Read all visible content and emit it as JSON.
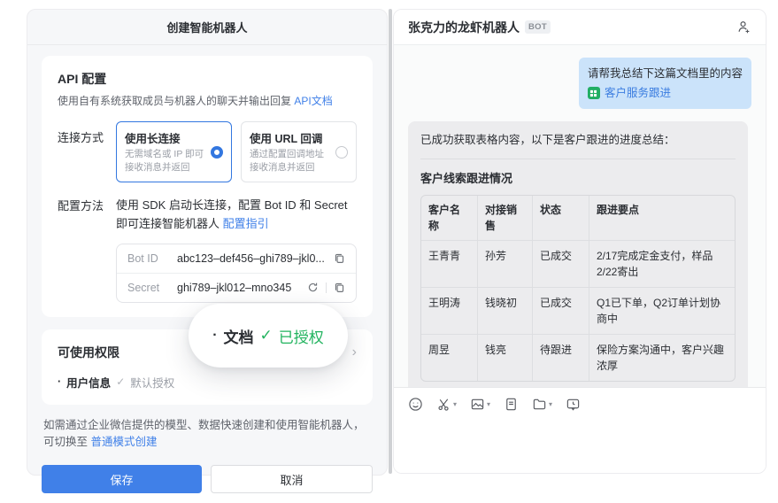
{
  "colors": {
    "accent_blue": "#4080e8",
    "radio_blue": "#3377e0",
    "link_blue": "#3b7de0",
    "success_green": "#21b35e",
    "attachment_green": "#21ae63",
    "user_bubble": "#cbe3fa",
    "bot_bubble": "#ececee",
    "panel_bg": "#f6f7f9"
  },
  "left_panel": {
    "title": "创建智能机器人",
    "api_section": {
      "title": "API 配置",
      "desc": "使用自有系统获取成员与机器人的聊天并输出回复",
      "doc_link": "API文档",
      "connection_label": "连接方式",
      "options": [
        {
          "title": "使用长连接",
          "desc1": "无需域名或 IP 即可",
          "desc2": "接收消息并返回",
          "selected": true
        },
        {
          "title": "使用 URL 回调",
          "desc1": "通过配置回调地址",
          "desc2": "接收消息并返回",
          "selected": false
        }
      ],
      "config_label": "配置方法",
      "config_desc": "使用 SDK 启动长连接，配置 Bot ID 和 Secret 即可连接智能机器人",
      "config_link": "配置指引",
      "credentials": {
        "bot_id_label": "Bot ID",
        "bot_id_value": "abc123–def456–ghi789–jkl0...",
        "secret_label": "Secret",
        "secret_value": "ghi789–jkl012–mno345"
      }
    },
    "permission_section": {
      "title": "可使用权限",
      "items": [
        {
          "bullet": "·",
          "name": "用户信息",
          "check": "✓",
          "status": "默认授权"
        },
        {
          "bullet": "·",
          "name": "文档",
          "check": "✓",
          "status": "已授权"
        }
      ]
    },
    "footer_note": "如需通过企业微信提供的模型、数据快速创建和使用智能机器人，可切换至 ",
    "footer_link": "普通模式创建",
    "save_label": "保存",
    "cancel_label": "取消"
  },
  "right_panel": {
    "title": "张克力的龙虾机器人",
    "bot_badge": "BOT",
    "user_message": {
      "text": "请帮我总结下这篇文档里的内容",
      "attachment_name": "客户服务跟进"
    },
    "bot_message": {
      "intro": "已成功获取表格内容，以下是客户跟进的进度总结：",
      "table_title": "客户线索跟进情况",
      "table": {
        "headers": [
          "客户名称",
          "对接销售",
          "状态",
          "跟进要点"
        ],
        "rows": [
          [
            "王青青",
            "孙芳",
            "已成交",
            "2/17完成定金支付，样品2/22寄出"
          ],
          [
            "王明涛",
            "钱晓初",
            "已成交",
            "Q1已下单，Q2订单计划协商中"
          ],
          [
            "周昱",
            "钱亮",
            "待跟进",
            "保险方案沟通中，客户兴趣浓厚"
          ]
        ]
      }
    },
    "toolbar_icons": [
      "emoji",
      "screenshot-scissors",
      "image",
      "file-document",
      "folder",
      "chat-history"
    ]
  }
}
